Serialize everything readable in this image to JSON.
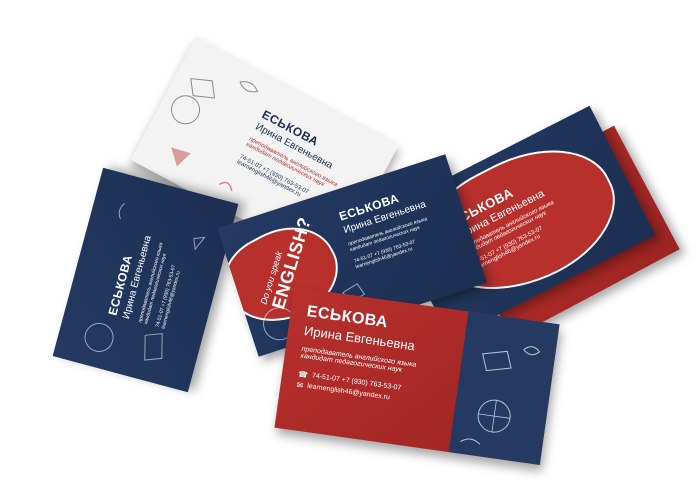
{
  "card": {
    "surname": "ЕСЬКОВА",
    "given_name": "Ирина Евгеньевна",
    "role_line_1": "преподаватель английского языка",
    "role_line_2": "кандидат педагогических наук",
    "phones": "74-51-07 +7 (930) 763-53-07",
    "email": "learnenglish46@yandex.ru",
    "promo_top": "Do you speak",
    "promo_word": "ENGLISH?"
  },
  "colors": {
    "navy": "#243a63",
    "red": "#b7302c",
    "paper": "#f3f3f3",
    "chalk": "#ffffff"
  }
}
